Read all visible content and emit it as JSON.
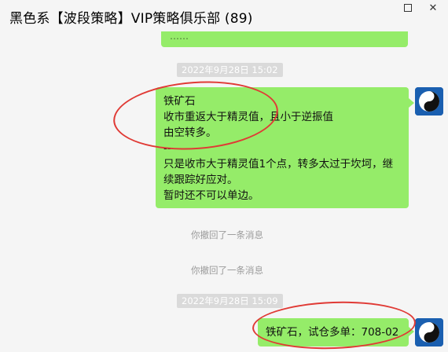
{
  "window": {
    "title": "黑色系【波段策略】VIP策略俱乐部   (89)"
  },
  "controls": {
    "maximize_icon": "maximize-icon",
    "close_icon": "close-icon"
  },
  "messages": {
    "partial_prev": "……",
    "timestamp1": "2022年9月28日 15:02",
    "main_lines": [
      "铁矿石",
      "收市重返大于精灵值，且小于逆振值",
      "由空转多。",
      "--------",
      "只是收市大于精灵值1个点，转多太过于坎坷，继续跟踪好应对。",
      "暂时还不可以单边。"
    ],
    "recall1": "你撤回了一条消息",
    "recall2": "你撤回了一条消息",
    "timestamp2": "2022年9月28日 15:09",
    "bottom_text": "铁矿石，试仓多单：708-02"
  },
  "colors": {
    "bubble_green": "#95ec69",
    "highlight_red": "#e03a35",
    "background": "#f5f5f5",
    "avatar_blue": "#1a5fb0"
  }
}
